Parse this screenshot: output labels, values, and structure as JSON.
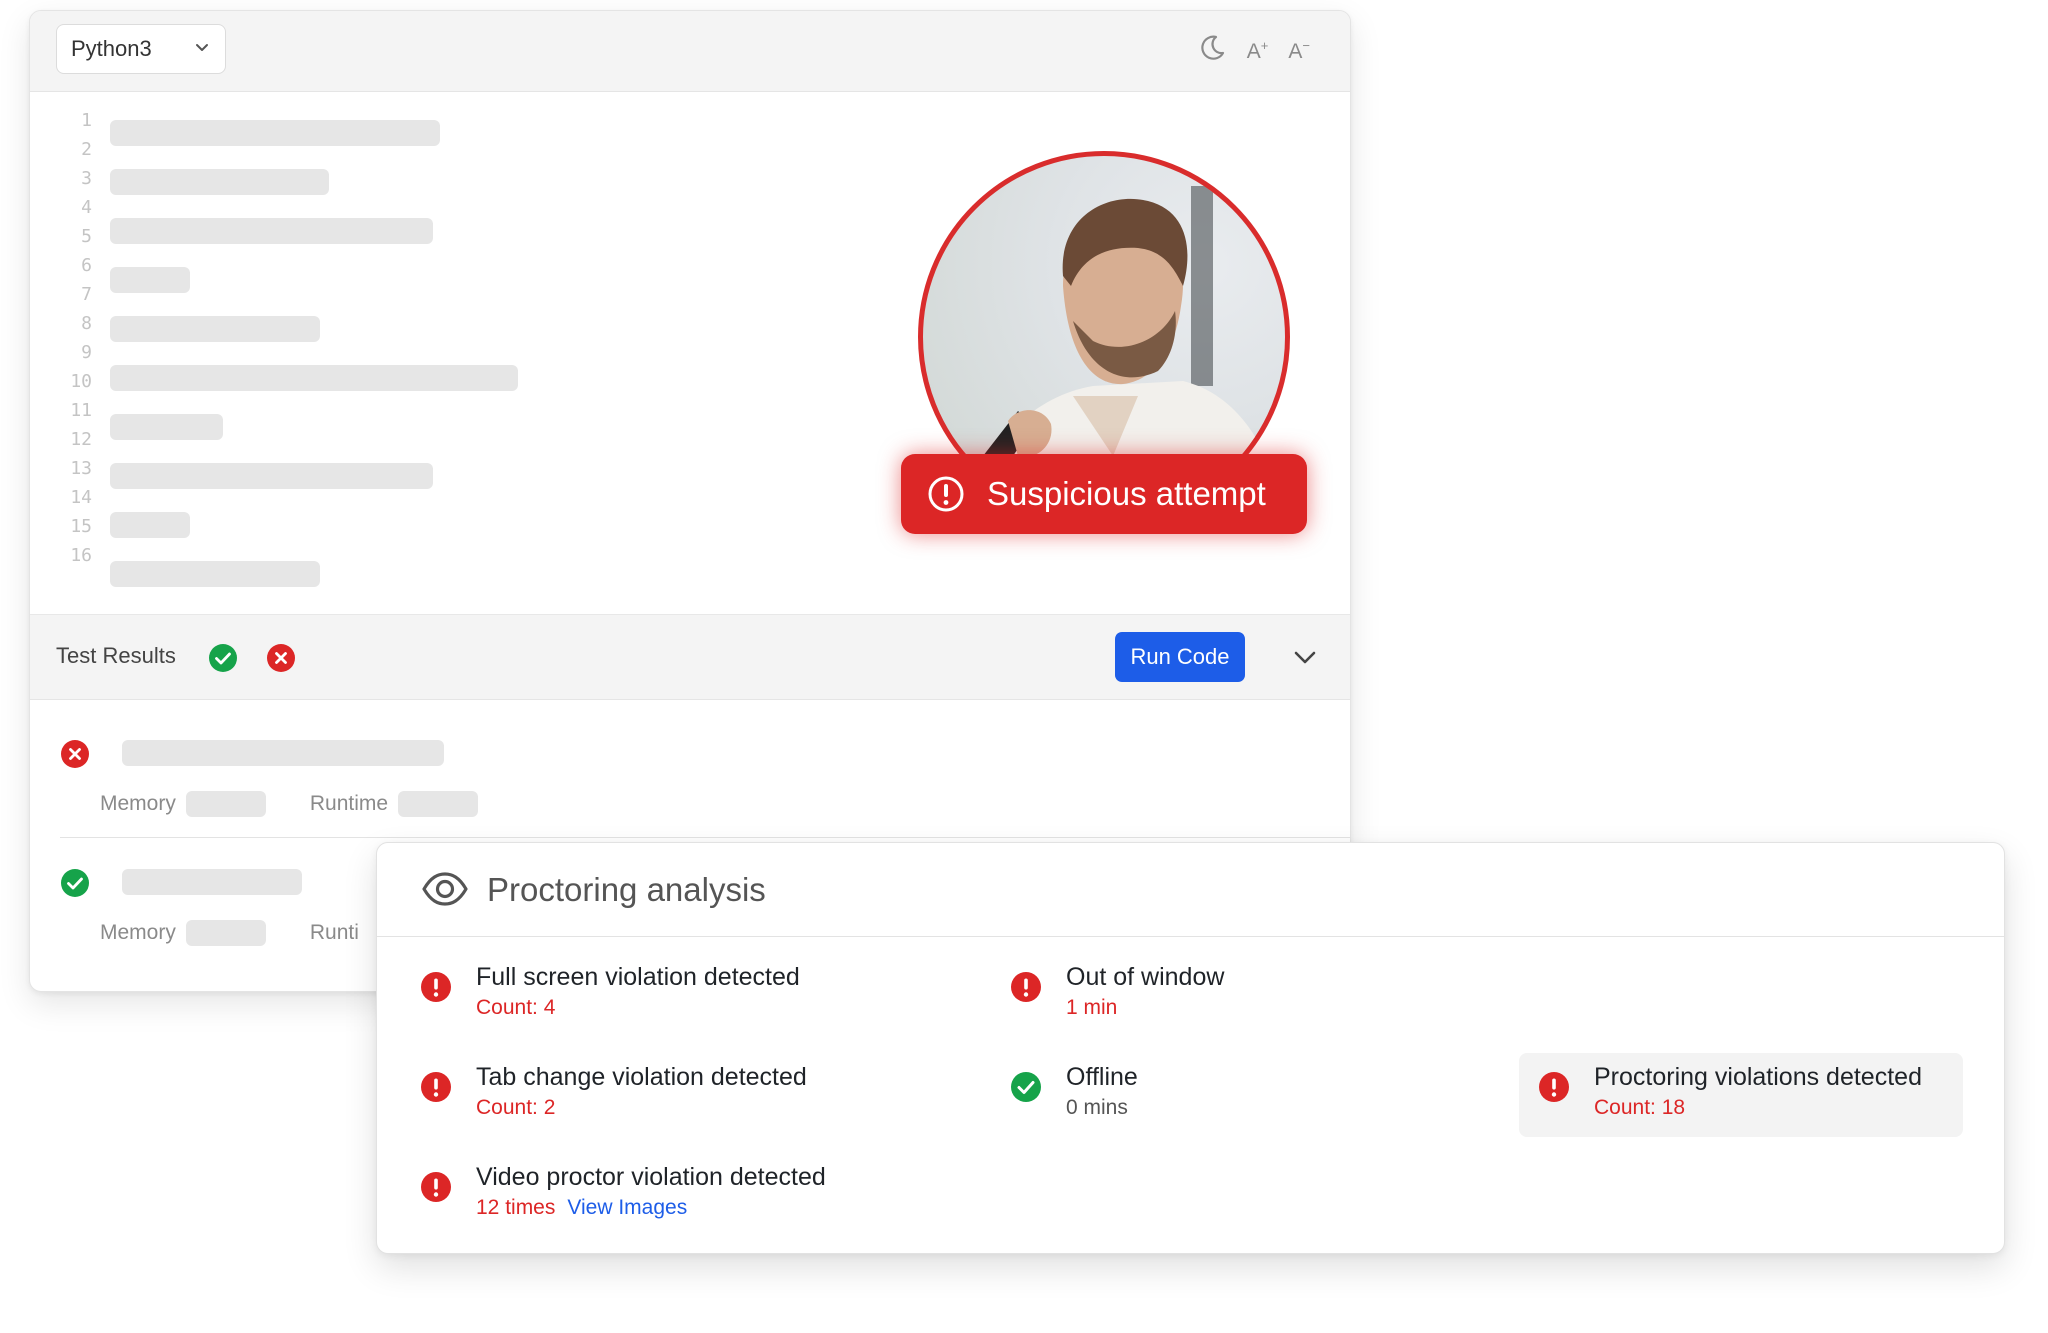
{
  "editor": {
    "language": "Python3",
    "toolbar_icons": [
      "moon-icon",
      "font-increase-icon",
      "font-decrease-icon"
    ],
    "font_increase": "A",
    "font_decrease": "A",
    "line_numbers": [
      "1",
      "2",
      "3",
      "4",
      "5",
      "6",
      "7",
      "8",
      "9",
      "10",
      "11",
      "12",
      "13",
      "14",
      "15",
      "16"
    ],
    "alert": "Suspicious attempt",
    "test_results_label": "Test Results",
    "run_button": "Run Code",
    "test_rows": [
      {
        "status": "fail",
        "memory_label": "Memory",
        "runtime_label": "Runtime"
      },
      {
        "status": "pass",
        "memory_label": "Memory",
        "runtime_label": "Runti"
      }
    ]
  },
  "proctoring": {
    "title": "Proctoring analysis",
    "items": [
      {
        "title": "Full screen violation detected",
        "detail": "Count: 4",
        "status": "error"
      },
      {
        "title": "Out of window",
        "detail": "1 min",
        "status": "error"
      },
      {
        "title": "Tab change violation detected",
        "detail": "Count: 2",
        "status": "error"
      },
      {
        "title": "Offline",
        "detail": "0 mins",
        "status": "ok"
      },
      {
        "title": "Proctoring violations detected",
        "detail": "Count: 18",
        "status": "error"
      },
      {
        "title": "Video proctor violation detected",
        "detail": "12 times",
        "link": "View Images",
        "status": "error"
      }
    ]
  },
  "colors": {
    "danger": "#dc2626",
    "success": "#16a34a",
    "primary": "#1d5de8"
  }
}
